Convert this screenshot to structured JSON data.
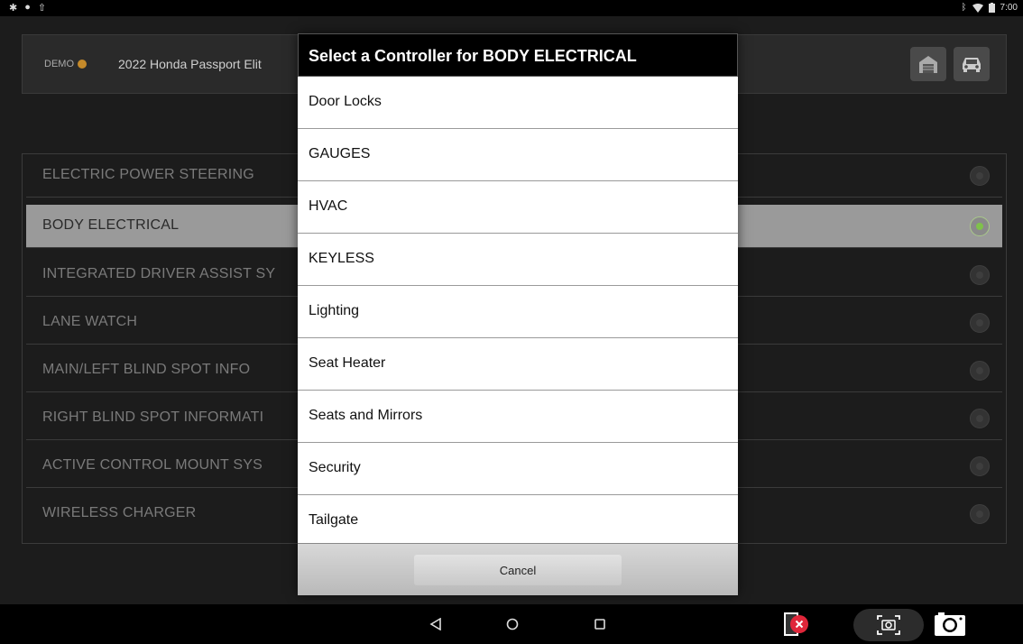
{
  "status_bar": {
    "left_icons": [
      "bug-icon",
      "android-icon",
      "upload-icon"
    ],
    "time": "7:00"
  },
  "header": {
    "demo_label": "DEMO",
    "vehicle": "2022 Honda Passport Elit"
  },
  "systems": [
    {
      "label": "ELECTRIC POWER STEERING",
      "selected": false
    },
    {
      "label": "BODY ELECTRICAL",
      "selected": true
    },
    {
      "label": "INTEGRATED DRIVER ASSIST SY",
      "selected": false
    },
    {
      "label": "LANE WATCH",
      "selected": false
    },
    {
      "label": "MAIN/LEFT BLIND SPOT INFO",
      "selected": false
    },
    {
      "label": "RIGHT BLIND SPOT INFORMATI",
      "selected": false
    },
    {
      "label": "ACTIVE CONTROL MOUNT SYS",
      "selected": false
    },
    {
      "label": "WIRELESS CHARGER",
      "selected": false
    }
  ],
  "dialog": {
    "title": "Select a Controller for BODY ELECTRICAL",
    "options": [
      "Door Locks",
      "GAUGES",
      "HVAC",
      "KEYLESS",
      "Lighting",
      "Seat Heater",
      "Seats and Mirrors",
      "Security",
      "Tailgate"
    ],
    "cancel_label": "Cancel"
  },
  "colors": {
    "accent_green": "#7fc24a",
    "record_red": "#e0263a"
  }
}
